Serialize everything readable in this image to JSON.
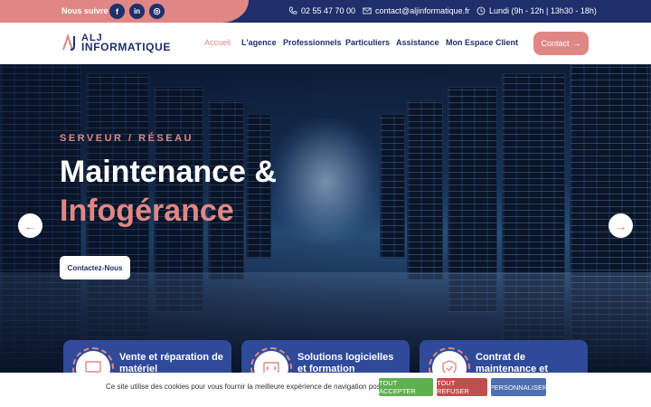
{
  "topbar": {
    "follow_label": "Nous suivre :",
    "social": [
      {
        "name": "facebook-icon",
        "glyph": "f"
      },
      {
        "name": "linkedin-icon",
        "glyph": "in"
      },
      {
        "name": "instagram-icon",
        "glyph": "◎"
      }
    ],
    "phone": "02 55 47 70 00",
    "email": "contact@aljinformatique.fr",
    "hours": "Lundi (9h - 12h | 13h30 - 18h)"
  },
  "header": {
    "logo_top": "ALJ",
    "logo_bottom": "INFORMATIQUE",
    "nav": [
      "Accueil",
      "L'agence",
      "Professionnels",
      "Particuliers",
      "Assistance",
      "Mon Espace Client"
    ],
    "contact_label": "Contact"
  },
  "hero": {
    "eyebrow": "SERVEUR / RÉSEAU",
    "title_line1": "Maintenance &",
    "title_line2": "Infogérance",
    "cta_label": "Contactez-Nous",
    "prev_glyph": "←",
    "next_glyph": "→"
  },
  "cards": [
    {
      "title": "Vente et réparation de matériel",
      "icon": "monitor-icon"
    },
    {
      "title": "Solutions logicielles et formation",
      "icon": "software-icon"
    },
    {
      "title": "Contrat de maintenance et",
      "icon": "shield-icon"
    }
  ],
  "cookie": {
    "text": "Ce site utilise des cookies pour vous fournir la meilleure expérience de navigation possible.",
    "accept": "TOUT ACCEPTER",
    "refuse": "TOUT REFUSER",
    "customize": "PERSONNALISER"
  },
  "colors": {
    "primary": "#1f2f6b",
    "accent": "#e08785",
    "card": "#2f4a99",
    "accept": "#5fb04f",
    "refuse": "#c0504d",
    "customize": "#4e6fb0"
  }
}
